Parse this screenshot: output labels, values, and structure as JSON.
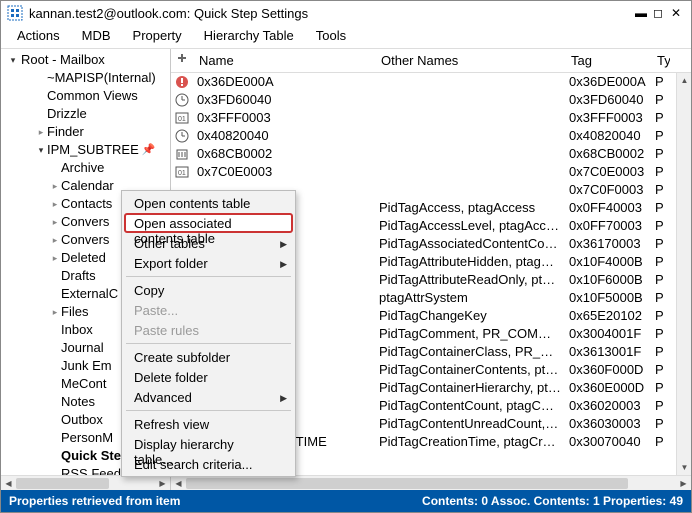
{
  "title": "kannan.test2@outlook.com: Quick Step Settings",
  "menubar": [
    "Actions",
    "MDB",
    "Property",
    "Hierarchy Table",
    "Tools"
  ],
  "tree": {
    "root": {
      "label": "Root - Mailbox",
      "expanded": "open"
    },
    "items": [
      {
        "label": "~MAPISP(Internal)",
        "indent": 2,
        "arrow": ""
      },
      {
        "label": "Common Views",
        "indent": 2,
        "arrow": ""
      },
      {
        "label": "Drizzle",
        "indent": 2,
        "arrow": ""
      },
      {
        "label": "Finder",
        "indent": 2,
        "arrow": "closed"
      },
      {
        "label": "IPM_SUBTREE",
        "indent": 2,
        "arrow": "open",
        "pin": true
      },
      {
        "label": "Archive",
        "indent": 3,
        "arrow": ""
      },
      {
        "label": "Calendar",
        "indent": 3,
        "arrow": "closed"
      },
      {
        "label": "Contacts",
        "indent": 3,
        "arrow": "closed"
      },
      {
        "label": "Convers",
        "indent": 3,
        "arrow": "closed"
      },
      {
        "label": "Convers",
        "indent": 3,
        "arrow": "closed"
      },
      {
        "label": "Deleted ",
        "indent": 3,
        "arrow": "closed"
      },
      {
        "label": "Drafts",
        "indent": 3,
        "arrow": ""
      },
      {
        "label": "ExternalC",
        "indent": 3,
        "arrow": ""
      },
      {
        "label": "Files",
        "indent": 3,
        "arrow": "closed"
      },
      {
        "label": "Inbox",
        "indent": 3,
        "arrow": ""
      },
      {
        "label": "Journal",
        "indent": 3,
        "arrow": ""
      },
      {
        "label": "Junk Em",
        "indent": 3,
        "arrow": ""
      },
      {
        "label": "MeCont",
        "indent": 3,
        "arrow": ""
      },
      {
        "label": "Notes",
        "indent": 3,
        "arrow": ""
      },
      {
        "label": "Outbox",
        "indent": 3,
        "arrow": ""
      },
      {
        "label": "PersonM",
        "indent": 3,
        "arrow": ""
      },
      {
        "label": "Quick Step Setti",
        "indent": 3,
        "arrow": "",
        "selected": true
      },
      {
        "label": "RSS Feeds",
        "indent": 3,
        "arrow": ""
      }
    ]
  },
  "columns": {
    "icon": "",
    "name": "Name",
    "other": "Other Names",
    "tag": "Tag",
    "type": "Ty"
  },
  "properties": [
    {
      "icon": "warn",
      "name": "0x36DE000A",
      "other": "",
      "tag": "0x36DE000A",
      "type": "P"
    },
    {
      "icon": "clock",
      "name": "0x3FD60040",
      "other": "",
      "tag": "0x3FD60040",
      "type": "P"
    },
    {
      "icon": "num",
      "name": "0x3FFF0003",
      "other": "",
      "tag": "0x3FFF0003",
      "type": "P"
    },
    {
      "icon": "clock",
      "name": "0x40820040",
      "other": "",
      "tag": "0x40820040",
      "type": "P"
    },
    {
      "icon": "bin",
      "name": "0x68CB0002",
      "other": "",
      "tag": "0x68CB0002",
      "type": "P"
    },
    {
      "icon": "num",
      "name": "0x7C0E0003",
      "other": "",
      "tag": "0x7C0E0003",
      "type": "P"
    },
    {
      "icon": "",
      "name": "",
      "other": "",
      "tag": "0x7C0F0003",
      "type": "P"
    },
    {
      "icon": "",
      "name": "",
      "other": "PidTagAccess, ptagAccess",
      "tag": "0x0FF40003",
      "type": "P"
    },
    {
      "icon": "",
      "name": "",
      "other": "PidTagAccessLevel, ptagAccessLe...",
      "tag": "0x0FF70003",
      "type": "P"
    },
    {
      "icon": "",
      "name": "NT_COUNT",
      "other": "PidTagAssociatedContentCount",
      "tag": "0x36170003",
      "type": "P"
    },
    {
      "icon": "",
      "name": "",
      "other": "PidTagAttributeHidden, ptagAttr...",
      "tag": "0x10F4000B",
      "type": "P"
    },
    {
      "icon": "",
      "name": "LY",
      "other": "PidTagAttributeReadOnly, ptagA...",
      "tag": "0x10F6000B",
      "type": "P"
    },
    {
      "icon": "",
      "name": "",
      "other": "ptagAttrSystem",
      "tag": "0x10F5000B",
      "type": "P"
    },
    {
      "icon": "",
      "name": "",
      "other": "PidTagChangeKey",
      "tag": "0x65E20102",
      "type": "P"
    },
    {
      "icon": "",
      "name": "",
      "other": "PidTagComment, PR_COMMENT,...",
      "tag": "0x3004001F",
      "type": "P"
    },
    {
      "icon": "",
      "name": "ASS_W",
      "other": "PidTagContainerClass, PR_CONTA...",
      "tag": "0x3613001F",
      "type": "P"
    },
    {
      "icon": "",
      "name": "ONTENTS",
      "other": "PidTagContainerContents, ptagC...",
      "tag": "0x360F000D",
      "type": "P"
    },
    {
      "icon": "",
      "name": "IERARCHY",
      "other": "PidTagContainerHierarchy, ptag...",
      "tag": "0x360E000D",
      "type": "P"
    },
    {
      "icon": "",
      "name": "UNT",
      "other": "PidTagContentCount, ptagConte...",
      "tag": "0x36020003",
      "type": "P"
    },
    {
      "icon": "",
      "name": "READ",
      "other": "PidTagContentUnreadCount, pta...",
      "tag": "0x36030003",
      "type": "P"
    },
    {
      "icon": "clock",
      "name": "PR_CREATION_TIME",
      "other": "PidTagCreationTime, ptagCreatio...",
      "tag": "0x30070040",
      "type": "P"
    }
  ],
  "context_menu": [
    {
      "label": "Open contents table"
    },
    {
      "label": "Open associated contents table",
      "highlight": true
    },
    {
      "label": "Other tables",
      "submenu": true
    },
    {
      "label": "Export folder",
      "submenu": true
    },
    {
      "sep": true
    },
    {
      "label": "Copy"
    },
    {
      "label": "Paste...",
      "disabled": true
    },
    {
      "label": "Paste rules",
      "disabled": true
    },
    {
      "sep": true
    },
    {
      "label": "Create subfolder"
    },
    {
      "label": "Delete folder"
    },
    {
      "label": "Advanced",
      "submenu": true
    },
    {
      "sep": true
    },
    {
      "label": "Refresh view"
    },
    {
      "label": "Display hierarchy table..."
    },
    {
      "label": "Edit search criteria..."
    }
  ],
  "statusbar": {
    "left": "Properties retrieved from item",
    "right": "Contents: 0  Assoc. Contents: 1   Properties: 49"
  }
}
